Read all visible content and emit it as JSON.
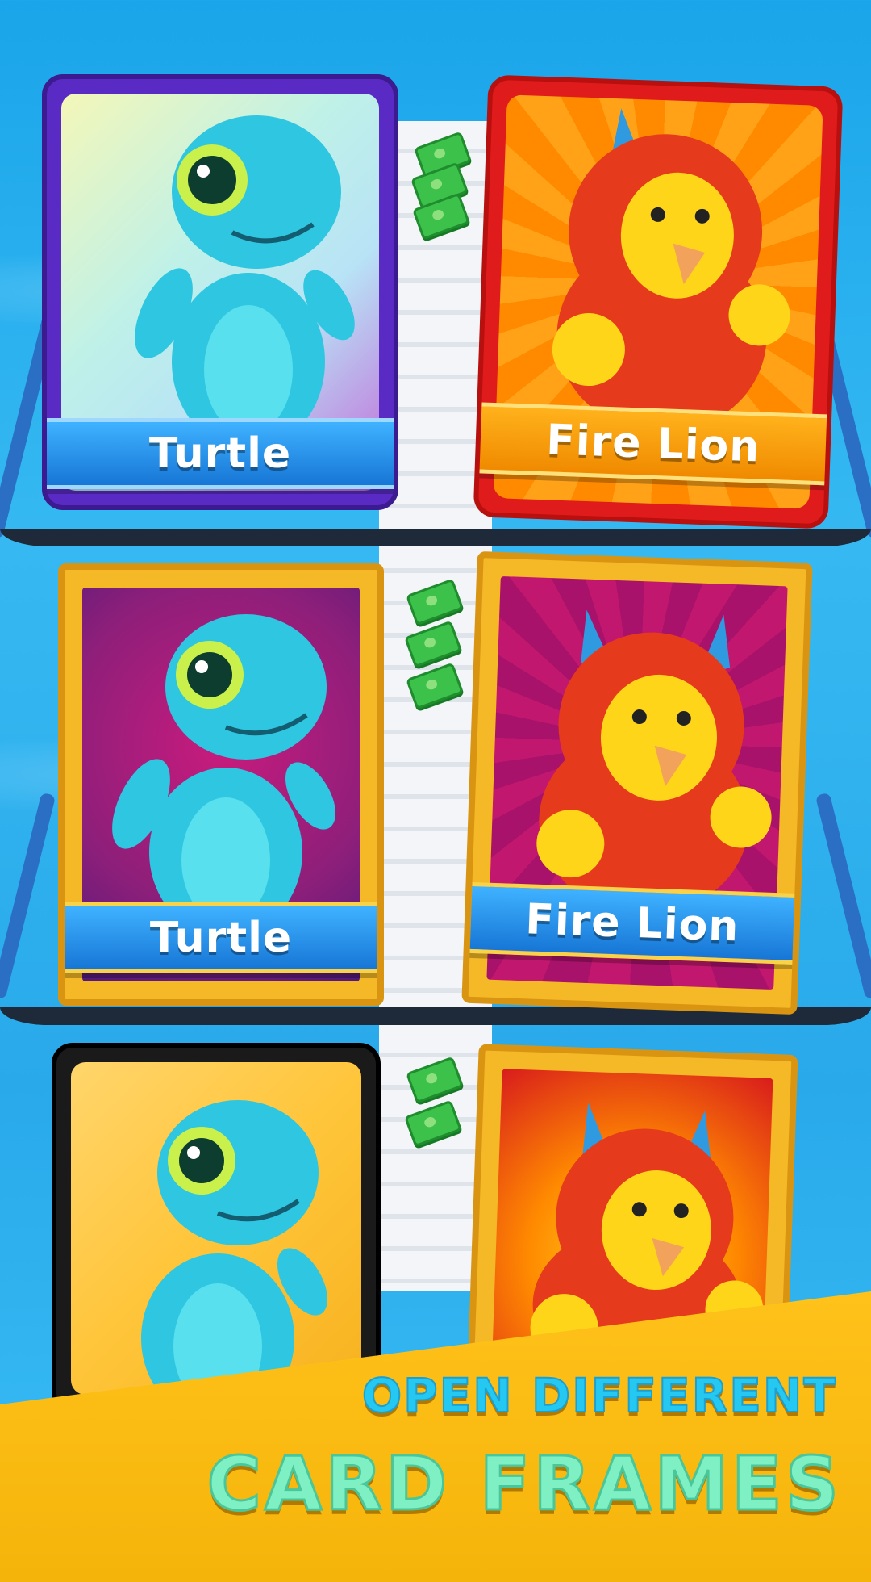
{
  "rows": [
    {
      "left": {
        "name": "Turtle",
        "frame": "holographic-purple"
      },
      "right": {
        "name": "Fire Lion",
        "frame": "red"
      }
    },
    {
      "left": {
        "name": "Turtle",
        "frame": "gold-magenta"
      },
      "right": {
        "name": "Fire Lion",
        "frame": "gold-magenta"
      }
    },
    {
      "left": {
        "name": "",
        "frame": "black-yellow"
      },
      "right": {
        "name": "",
        "frame": "gold-fire"
      }
    }
  ],
  "promo": {
    "line1": "OPEN DIFFERENT",
    "line2": "CARD FRAMES"
  },
  "colors": {
    "turtle": "#2ec6e0",
    "lion_body": "#e53a1c",
    "lion_face": "#ffd51a",
    "horn": "#2f9ae0"
  }
}
